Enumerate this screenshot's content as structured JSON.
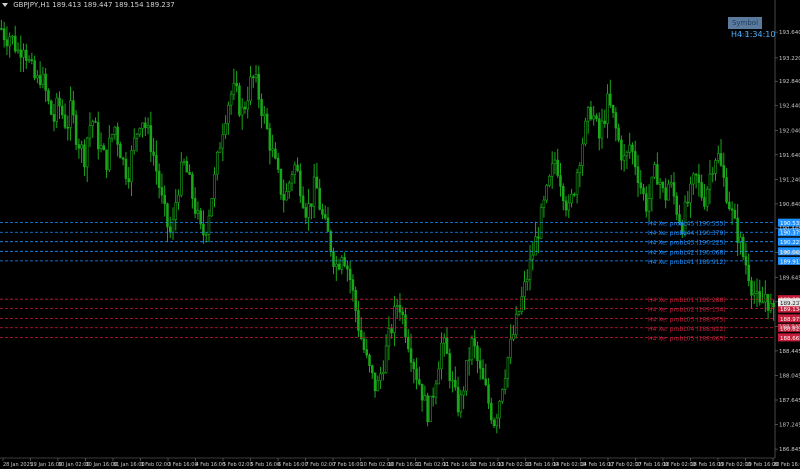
{
  "header": {
    "symbol_label": "GBPJPY,H1",
    "ohlc": "189.413 189.447 189.154 189.237"
  },
  "widget": {
    "button_label": "Symbol off",
    "countdown": "H4 1:34:10"
  },
  "colors": {
    "background": "#000000",
    "candle": "#19a819",
    "grid": "#1a1a1a",
    "level_blue": "#1e90ff",
    "level_red": "#c41e3a",
    "current_price": "#c41e3a"
  },
  "price_axis": {
    "labels": [
      "193.640",
      "193.220",
      "192.840",
      "192.440",
      "192.040",
      "191.640",
      "191.240",
      "190.840",
      "190.445",
      "190.045",
      "189.645",
      "189.245",
      "188.845",
      "188.445",
      "188.045",
      "187.645",
      "187.245",
      "186.845"
    ]
  },
  "time_axis": {
    "labels": [
      "28 Jan 2025",
      "29 Jan 16:00",
      "30 Jan 02:00",
      "30 Jan 16:00",
      "31 Jan 16:00",
      "3 Feb 02:00",
      "3 Feb 16:00",
      "4 Feb 16:00",
      "5 Feb 02:00",
      "5 Feb 16:00",
      "6 Feb 16:00",
      "7 Feb 02:00",
      "7 Feb 16:00",
      "10 Feb 02:00",
      "10 Feb 16:00",
      "11 Feb 02:00",
      "11 Feb 16:00",
      "12 Feb 16:00",
      "13 Feb 02:00",
      "13 Feb 16:00",
      "14 Feb 02:00",
      "14 Feb 16:00",
      "17 Feb 02:00",
      "17 Feb 16:00",
      "18 Feb 02:00",
      "18 Feb 16:00",
      "19 Feb 02:00",
      "19 Feb 16:00",
      "20 Feb 16:00"
    ]
  },
  "levels": {
    "blue": [
      {
        "label": "H4 Xe: probL45 (190.535)",
        "tag": "190.535"
      },
      {
        "label": "H4 Xe: probL44 (190.379)",
        "tag": "190.379"
      },
      {
        "label": "H4 Xe: probL43 (190.225)",
        "tag": "190.225"
      },
      {
        "label": "H4 Xe: probL42 (190.068)",
        "tag": "190.068"
      },
      {
        "label": "H4 Xe: probL41 (189.912)",
        "tag": "189.912"
      }
    ],
    "red": [
      {
        "label": "H4 Xe: probL01 (189.288)",
        "tag": "189.288"
      },
      {
        "label": "H4 Xe: probL02 (189.134)",
        "tag": "189.134"
      },
      {
        "label": "H4 Xe: probL03 (188.975)",
        "tag": "188.975"
      },
      {
        "label": "H4 Xe: probL04 (188.822)",
        "tag": "188.822"
      },
      {
        "label": "H4 Xe: probL05 (188.665)",
        "tag": "188.665"
      }
    ],
    "current_price_tag": "189.237"
  },
  "chart_data": {
    "type": "line",
    "style": "candlestick",
    "price_range": [
      186.7,
      194.0
    ],
    "x_count": 280,
    "close": [
      193.7,
      193.55,
      193.6,
      193.45,
      193.3,
      193.5,
      193.2,
      193.0,
      192.8,
      192.95,
      192.7,
      192.4,
      192.2,
      192.5,
      192.3,
      192.1,
      192.4,
      192.0,
      191.8,
      191.6,
      192.1,
      192.2,
      191.9,
      191.7,
      191.5,
      191.9,
      192.1,
      191.8,
      191.5,
      191.3,
      191.7,
      192.0,
      192.3,
      192.1,
      191.9,
      191.6,
      191.2,
      190.8,
      190.5,
      190.3,
      190.9,
      191.3,
      191.5,
      191.2,
      190.9,
      190.6,
      190.3,
      190.5,
      190.9,
      191.3,
      191.8,
      192.2,
      192.5,
      192.7,
      192.6,
      192.3,
      192.5,
      192.8,
      192.9,
      192.6,
      192.3,
      192.0,
      191.7,
      191.4,
      191.1,
      190.9,
      191.2,
      191.5,
      191.3,
      191.0,
      190.7,
      190.9,
      191.2,
      190.8,
      190.5,
      190.3,
      190.0,
      189.8,
      190.1,
      189.9,
      189.6,
      189.2,
      188.8,
      188.5,
      188.2,
      188.0,
      187.8,
      188.1,
      188.4,
      188.7,
      189.0,
      189.3,
      189.0,
      188.7,
      188.4,
      188.1,
      187.9,
      187.6,
      187.4,
      187.8,
      188.2,
      188.6,
      188.4,
      188.0,
      187.7,
      187.5,
      187.9,
      188.3,
      188.6,
      188.3,
      188.0,
      187.8,
      187.5,
      187.3,
      187.6,
      188.0,
      188.3,
      188.6,
      188.9,
      189.2,
      189.5,
      189.8,
      190.1,
      190.4,
      190.7,
      191.0,
      191.3,
      191.6,
      191.3,
      191.0,
      190.7,
      191.0,
      191.4,
      191.8,
      192.1,
      192.4,
      192.2,
      191.9,
      192.2,
      192.5,
      192.3,
      192.0,
      191.7,
      191.5,
      191.8,
      191.6,
      191.3,
      191.0,
      190.8,
      191.1,
      191.4,
      191.2,
      190.9,
      191.2,
      191.0,
      190.7,
      190.5,
      190.8,
      191.0,
      191.3,
      191.1,
      190.9,
      191.2,
      191.5,
      191.7,
      191.4,
      191.1,
      190.8,
      190.5,
      190.3,
      190.0,
      189.8,
      189.5,
      189.3,
      189.1,
      189.4,
      189.2,
      189.0
    ]
  }
}
